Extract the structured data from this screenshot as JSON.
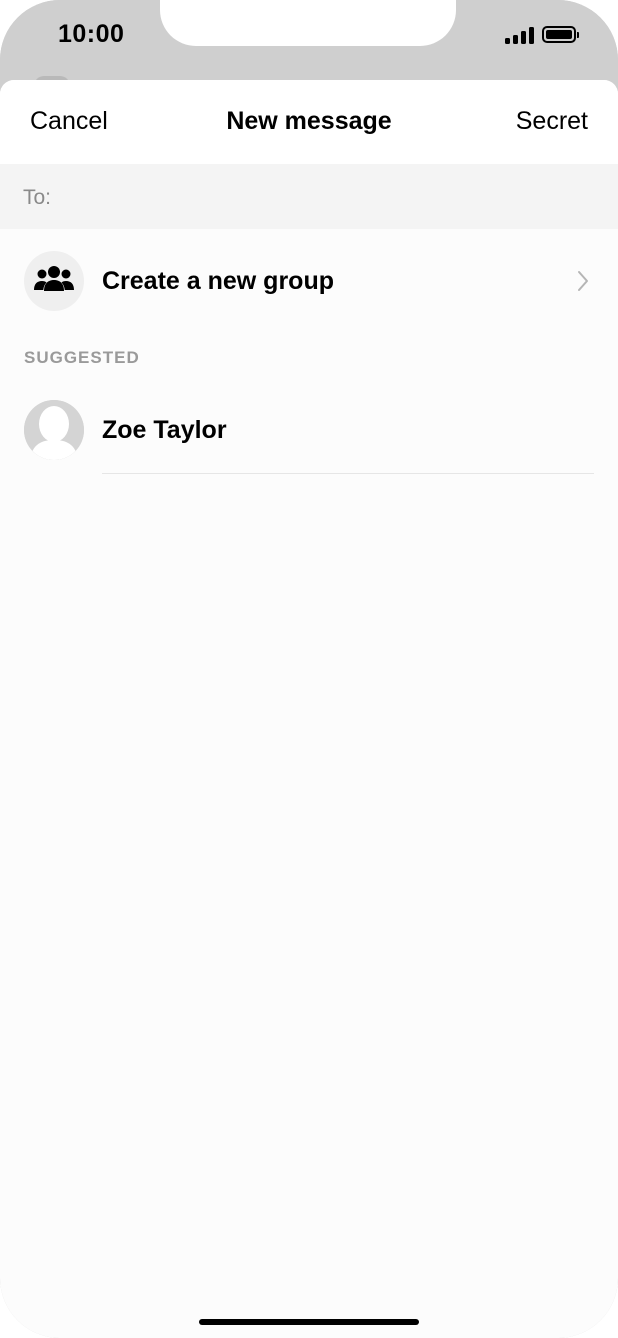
{
  "status_bar": {
    "time": "10:00"
  },
  "nav": {
    "cancel_label": "Cancel",
    "title": "New message",
    "secret_label": "Secret"
  },
  "to_field": {
    "label": "To:",
    "value": ""
  },
  "group_row": {
    "label": "Create a new group",
    "icon": "group-icon"
  },
  "suggested": {
    "header": "SUGGESTED",
    "contacts": [
      {
        "name": "Zoe Taylor",
        "avatar": "default-avatar-icon"
      }
    ]
  },
  "colors": {
    "sheet_background": "#fcfcfc",
    "to_bar_background": "#f4f4f4",
    "section_header": "#9a9a9a",
    "status_bar_background": "#cfcfcf"
  }
}
